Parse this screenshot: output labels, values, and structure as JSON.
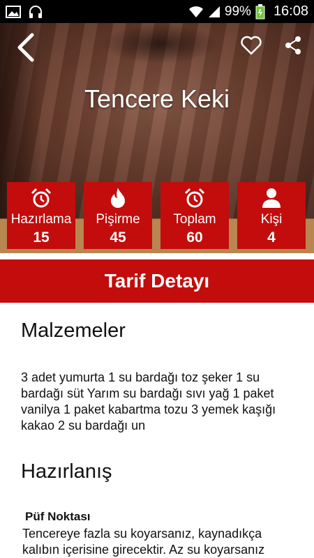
{
  "status_bar": {
    "battery": "99%",
    "time": "16:08",
    "icons": [
      "image-icon",
      "headphones-icon",
      "wifi-icon",
      "signal-icon",
      "battery-icon"
    ]
  },
  "hero": {
    "title": "Tencere Keki",
    "icons": {
      "back": "back-chevron-icon",
      "favorite": "heart-outline-icon",
      "share": "share-icon"
    }
  },
  "stats": [
    {
      "icon": "alarm-clock-icon",
      "label": "Hazırlama",
      "value": "15"
    },
    {
      "icon": "fire-icon",
      "label": "Pişirme",
      "value": "45"
    },
    {
      "icon": "alarm-clock-icon",
      "label": "Toplam",
      "value": "60"
    },
    {
      "icon": "person-icon",
      "label": "Kişi",
      "value": "4"
    }
  ],
  "section": {
    "title": "Tarif Detayı"
  },
  "ingredients": {
    "heading": "Malzemeler",
    "text": "3 adet yumurta 1 su bardağı toz şeker 1 su bardağı süt Yarım su bardağı sıvı yağ 1 paket vanilya 1 paket kabartma tozu 3 yemek kaşığı kakao 2 su bardağı un"
  },
  "preparation": {
    "heading": "Hazırlanış",
    "tip_title": "Püf Noktası",
    "tip_text": "Tencereye fazla su koyarsanız, kaynadıkça kalıbın içerisine girecektir. Az su koyarsanız"
  },
  "colors": {
    "accent": "#c30c0c",
    "band": "#b8864f",
    "status_bar": "#000000"
  }
}
